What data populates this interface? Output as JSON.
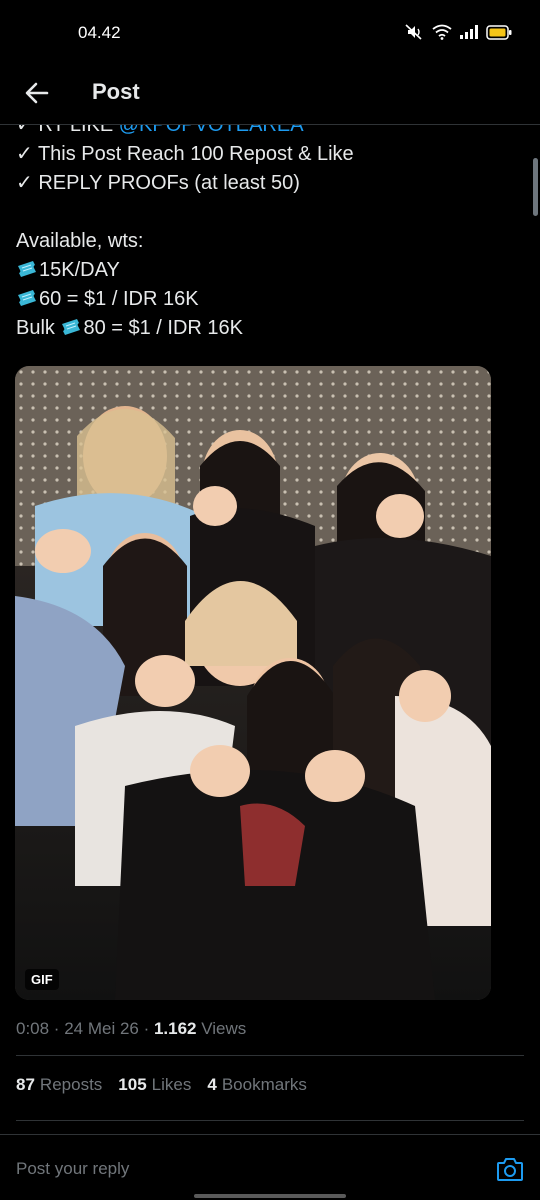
{
  "status_bar": {
    "time": "04.42"
  },
  "header": {
    "title": "Post"
  },
  "post": {
    "lines": [
      {
        "check": "✓ ",
        "text": "RT LIKE ",
        "mention": "@KPOPVOTEAREA"
      },
      {
        "check": "✓ ",
        "text": "This Post Reach 100 Repost & Like"
      },
      {
        "check": "✓ ",
        "text": "REPLY PROOFs (at least 50)"
      }
    ],
    "available_label": "Available, wts:",
    "offer1": "15K/DAY",
    "offer2": "60 = $1 / IDR 16K",
    "offer3_prefix": "Bulk ",
    "offer3": "80 = $1 / IDR 16K",
    "media_badge": "GIF",
    "timestamp": "0:08 · 24 Mei 26 · ",
    "views_count": "1.162",
    "views_label": " Views"
  },
  "stats": {
    "reposts_count": "87",
    "reposts_label": "Reposts",
    "likes_count": "105",
    "likes_label": "Likes",
    "bookmarks_count": "4",
    "bookmarks_label": "Bookmarks"
  },
  "reply": {
    "placeholder": "Post your reply"
  },
  "colors": {
    "accent": "#1d9bf0",
    "background": "#000000",
    "text": "#e7e9ea",
    "muted": "#71767b",
    "border": "#2f3336"
  },
  "icons": {
    "back": "arrow-left-icon",
    "camera": "camera-icon",
    "ticket": "ticket-icon",
    "status": [
      "mute-icon",
      "wifi-icon",
      "signal-icon",
      "battery-icon"
    ]
  }
}
